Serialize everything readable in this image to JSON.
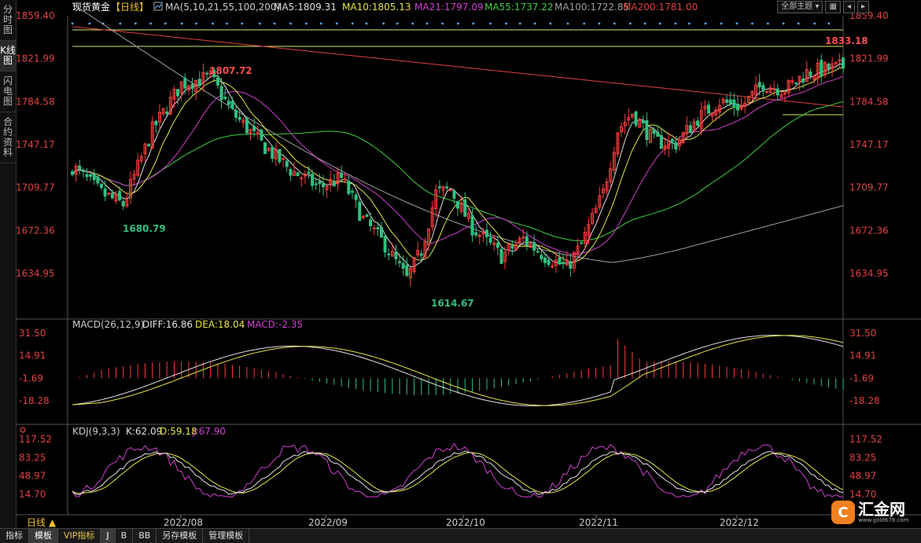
{
  "sidebar": {
    "tabs": [
      {
        "label": "分时图",
        "active": false
      },
      {
        "label": "K线图",
        "active": true
      },
      {
        "label": "闪电图",
        "active": false
      },
      {
        "label": "合约资料",
        "active": false
      }
    ]
  },
  "header": {
    "instrument": "现货黄金",
    "period": "【日线】",
    "ma_label": "MA(5,10,21,55,100,200)",
    "ma_values": [
      {
        "text": "MA5:1809.31",
        "color": "#e0e0e0"
      },
      {
        "text": "MA10:1805.13",
        "color": "#e6e645"
      },
      {
        "text": "MA21:1797.09",
        "color": "#d040d0"
      },
      {
        "text": "MA55:1737.22",
        "color": "#40d040"
      },
      {
        "text": "MA100:1722.85",
        "color": "#a0a0a0"
      },
      {
        "text": "MA200:1781.00",
        "color": "#e04040"
      }
    ],
    "theme_select": "全部主题"
  },
  "main_axis": [
    "1859.40",
    "1821.99",
    "1784.58",
    "1747.17",
    "1709.77",
    "1672.36",
    "1634.95"
  ],
  "annotations": {
    "high_label": "1833.18",
    "peak_label": "1807.72",
    "low1_label": "1680.79",
    "low2_label": "1614.67"
  },
  "macd": {
    "title": "MACD(26,12,9)",
    "diff": "DIFF:16.86",
    "dea": "DEA:18.04",
    "macd": "MACD:-2.35",
    "axis": [
      "31.50",
      "14.91",
      "-1.69",
      "-18.28"
    ]
  },
  "kdj": {
    "title": "KDJ(9,3,3)",
    "k": "K:62.09",
    "d": "D:59.18",
    "j": "J:67.90",
    "axis": [
      "117.52",
      "83.25",
      "48.97",
      "14.70"
    ]
  },
  "x_axis": {
    "period_label": "日线 ▲",
    "months": [
      "2022/08",
      "2022/09",
      "2022/10",
      "2022/11",
      "2022/12"
    ]
  },
  "bottom_tabs": [
    {
      "label": "指标",
      "active": false
    },
    {
      "label": "模板",
      "active": true
    },
    {
      "label": "VIP指标",
      "active": false
    },
    {
      "label": "J",
      "active": false
    },
    {
      "label": "B",
      "active": false
    },
    {
      "label": "BB",
      "active": false
    },
    {
      "label": "另存模板",
      "active": false
    },
    {
      "label": "管理模板",
      "active": false
    }
  ],
  "watermark": {
    "logo": "C",
    "name": "汇金网",
    "url": "www.gold678.com"
  },
  "colors": {
    "up": "#ff3c3c",
    "down": "#30c080",
    "ma5": "#e0e0e0",
    "ma10": "#e6e645",
    "ma21": "#d040d0",
    "ma55": "#40d040",
    "ma100": "#a0a0a0",
    "ma200": "#e04040"
  }
}
